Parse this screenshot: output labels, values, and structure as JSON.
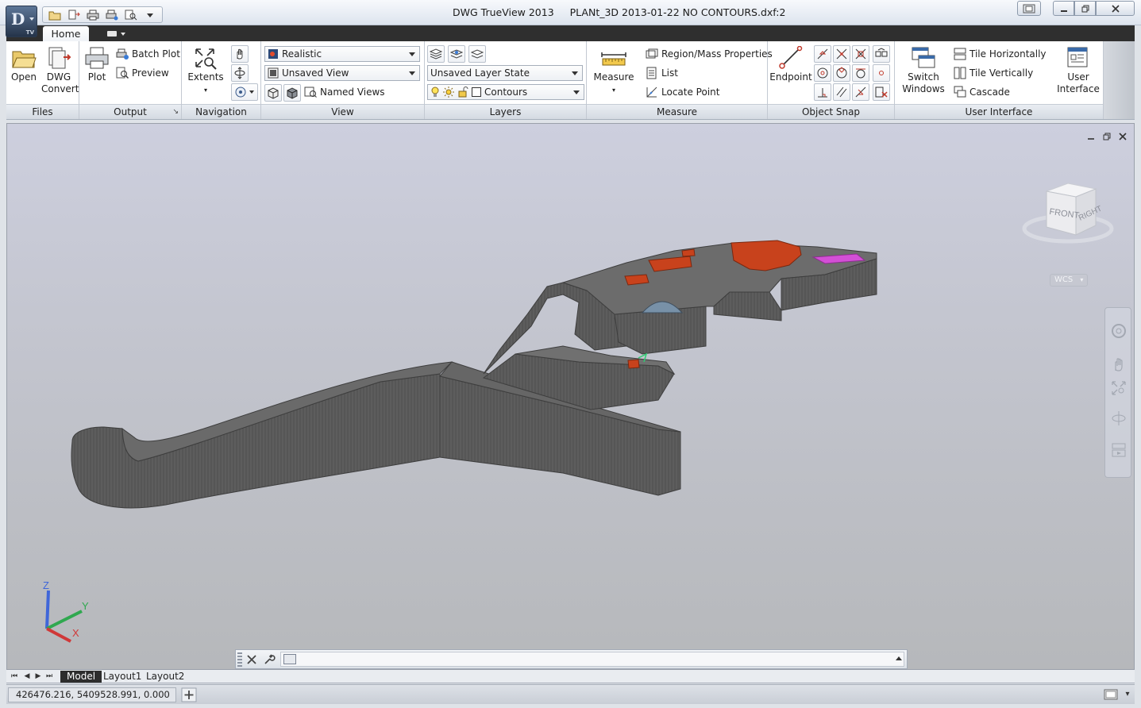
{
  "window": {
    "app_name": "DWG TrueView 2013",
    "document_name": "PLANt_3D 2013-01-22 NO CONTOURS.dxf:2",
    "app_logo": "D",
    "app_badge": "TV"
  },
  "tabs": {
    "home": "Home"
  },
  "ribbon": {
    "files": {
      "title": "Files",
      "open": "Open",
      "dwg_convert_1": "DWG",
      "dwg_convert_2": "Convert"
    },
    "output": {
      "title": "Output",
      "plot": "Plot",
      "batch_plot": "Batch Plot",
      "preview": "Preview"
    },
    "navigation": {
      "title": "Navigation",
      "extents": "Extents"
    },
    "view": {
      "title": "View",
      "visual_style": "Realistic",
      "view_select": "Unsaved View",
      "named_views": "Named Views"
    },
    "layers": {
      "title": "Layers",
      "layer_state": "Unsaved Layer State",
      "current_layer": "Contours"
    },
    "measure": {
      "title": "Measure",
      "measure": "Measure",
      "region_mass": "Region/Mass Properties",
      "list": "List",
      "locate_point": "Locate Point"
    },
    "object_snap": {
      "title": "Object Snap",
      "endpoint": "Endpoint"
    },
    "user_interface": {
      "title": "User Interface",
      "switch_1": "Switch",
      "switch_2": "Windows",
      "tile_h": "Tile Horizontally",
      "tile_v": "Tile Vertically",
      "cascade": "Cascade",
      "ui_1": "User",
      "ui_2": "Interface"
    }
  },
  "viewport": {
    "viewcube_front": "FRONT",
    "viewcube_right": "RIGHT",
    "wcs": "WCS",
    "ucs_x": "X",
    "ucs_y": "Y",
    "ucs_z": "Z"
  },
  "command_line": {
    "value": ""
  },
  "layout_tabs": [
    "Model",
    "Layout1",
    "Layout2"
  ],
  "status": {
    "coordinates": "426476.216, 5409528.991, 0.000"
  },
  "colors": {
    "ribbon_bg": "#ffffff",
    "tab_strip": "#2f2f2f",
    "model_gray": "#5f5f5f",
    "building_orange": "#c8421c",
    "highlight_magenta": "#d34fd6"
  },
  "icons": [
    "open-icon",
    "dwg-convert-icon",
    "plot-icon",
    "batch-plot-icon",
    "preview-icon",
    "extents-icon",
    "pan-icon",
    "orbit-icon",
    "steering-wheel-icon",
    "measure-icon",
    "region-mass-icon",
    "list-icon",
    "locate-point-icon",
    "endpoint-icon",
    "switch-windows-icon",
    "tile-horizontally-icon",
    "tile-vertically-icon",
    "cascade-icon",
    "user-interface-icon"
  ]
}
